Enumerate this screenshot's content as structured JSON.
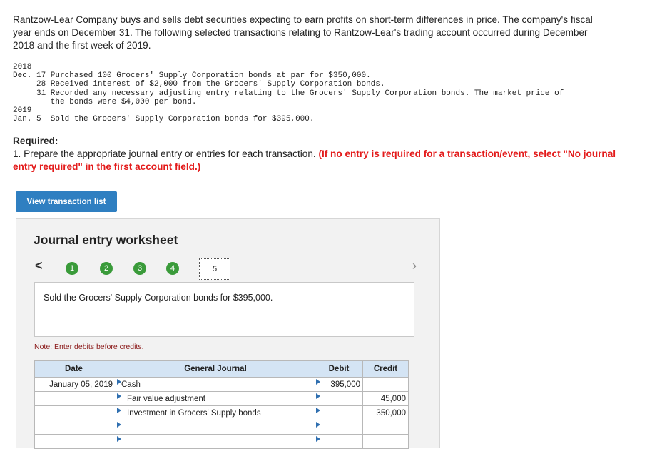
{
  "intro": "Rantzow-Lear Company buys and sells debt securities expecting to earn profits on short-term differences in price. The company's fiscal year ends on December 31. The following selected transactions relating to Rantzow-Lear's trading account occurred during December 2018 and the first week of 2019.",
  "transactions": {
    "year1": "2018",
    "line1": "Dec. 17 Purchased 100 Grocers' Supply Corporation bonds at par for $350,000.",
    "line2": "     28 Received interest of $2,000 from the Grocers' Supply Corporation bonds.",
    "line3": "     31 Recorded any necessary adjusting entry relating to the Grocers' Supply Corporation bonds. The market price of",
    "line4": "        the bonds were $4,000 per bond.",
    "year2": "2019",
    "line5": "Jan. 5  Sold the Grocers' Supply Corporation bonds for $395,000."
  },
  "required": {
    "heading": "Required:",
    "item": "1. Prepare the appropriate journal entry or entries for each transaction.",
    "instruction": "(If no entry is required for a transaction/event, select \"No journal entry required\" in the first account field.)"
  },
  "view_button": "View transaction list",
  "worksheet": {
    "title": "Journal entry worksheet",
    "prev": "<",
    "next": ">",
    "steps": [
      "1",
      "2",
      "3",
      "4"
    ],
    "current_step": "5",
    "description": "Sold the Grocers' Supply Corporation bonds for $395,000.",
    "note": "Note: Enter debits before credits.",
    "headers": {
      "date": "Date",
      "journal": "General Journal",
      "debit": "Debit",
      "credit": "Credit"
    },
    "rows": [
      {
        "date": "January 05, 2019",
        "account": "Cash",
        "debit": "395,000",
        "credit": "",
        "indent": false
      },
      {
        "date": "",
        "account": "Fair value adjustment",
        "debit": "",
        "credit": "45,000",
        "indent": true
      },
      {
        "date": "",
        "account": "Investment in Grocers' Supply bonds",
        "debit": "",
        "credit": "350,000",
        "indent": true
      },
      {
        "date": "",
        "account": "",
        "debit": "",
        "credit": "",
        "indent": false
      },
      {
        "date": "",
        "account": "",
        "debit": "",
        "credit": "",
        "indent": false
      }
    ]
  }
}
